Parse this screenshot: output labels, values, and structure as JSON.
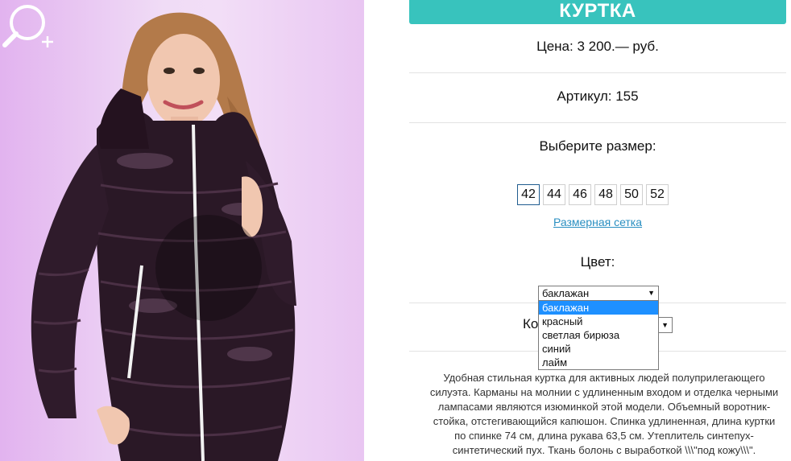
{
  "product": {
    "title": "КУРТКА",
    "price": "Цена: 3 200.— руб.",
    "article": "Артикул: 155",
    "size_prompt": "Выберите размер:",
    "sizes": [
      "42",
      "44",
      "46",
      "48",
      "50",
      "52"
    ],
    "selected_size": "42",
    "size_chart_link": "Размерная сетка",
    "color_label": "Цвет:",
    "color_selected": "баклажан",
    "color_options": [
      "баклажан",
      "красный",
      "светлая бирюза",
      "синий",
      "лайм"
    ],
    "qty_label": "Ко",
    "description": "Удобная стильная куртка для активных людей полуприлегающего силуэта. Карманы на молнии с удлиненным входом и отделка черными лампасами являются изюминкой этой модели. Объемный воротник-стойка, отстегивающийся капюшон. Спинка удлиненная, длина куртки по спинке 74 см, длина рукава 63,5 см. Утеплитель синтепух-синтетический пух. Ткань болонь с выработкой \\\\\\\"под кожу\\\\\\\"."
  },
  "icons": {
    "zoom": "zoom-in-magnifier-icon",
    "dropdown_arrow": "triangle-down"
  },
  "colors": {
    "accent": "#38c3bd",
    "link": "#2a8fc1",
    "selected_option": "#1e90ff",
    "jacket": "#2a1826"
  }
}
